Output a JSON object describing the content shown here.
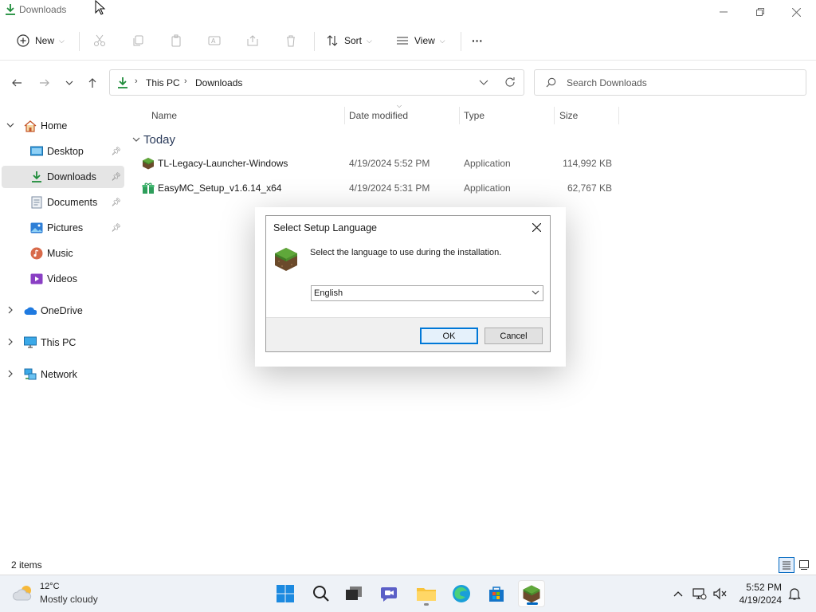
{
  "window": {
    "title": "Downloads"
  },
  "commandbar": {
    "new_label": "New",
    "sort_label": "Sort",
    "view_label": "View",
    "more_label": "···"
  },
  "address": {
    "crumbs": [
      "This PC",
      "Downloads"
    ],
    "search_placeholder": "Search Downloads"
  },
  "sidebar": {
    "items": [
      {
        "label": "Home",
        "icon": "home-icon"
      },
      {
        "label": "Desktop",
        "icon": "desktop-icon"
      },
      {
        "label": "Downloads",
        "icon": "download-icon"
      },
      {
        "label": "Documents",
        "icon": "documents-icon"
      },
      {
        "label": "Pictures",
        "icon": "pictures-icon"
      },
      {
        "label": "Music",
        "icon": "music-icon"
      },
      {
        "label": "Videos",
        "icon": "videos-icon"
      },
      {
        "label": "OneDrive",
        "icon": "onedrive-icon"
      },
      {
        "label": "This PC",
        "icon": "this-pc-icon"
      },
      {
        "label": "Network",
        "icon": "network-icon"
      }
    ]
  },
  "filelist": {
    "columns": [
      "Name",
      "Date modified",
      "Type",
      "Size"
    ],
    "group": "Today",
    "files": [
      {
        "name": "TL-Legacy-Launcher-Windows",
        "date": "4/19/2024 5:52 PM",
        "type": "Application",
        "size": "114,992 KB",
        "icon": "grass-block-icon"
      },
      {
        "name": "EasyMC_Setup_v1.6.14_x64",
        "date": "4/19/2024 5:31 PM",
        "type": "Application",
        "size": "62,767 KB",
        "icon": "installer-gift-icon"
      }
    ]
  },
  "status": {
    "count": "2 items"
  },
  "dialog": {
    "title": "Select Setup Language",
    "message": "Select the language to use during the installation.",
    "selected_language": "English",
    "ok_label": "OK",
    "cancel_label": "Cancel"
  },
  "taskbar": {
    "weather_temp": "12°C",
    "weather_desc": "Mostly cloudy",
    "time": "5:52 PM",
    "date": "4/19/2024"
  },
  "colors": {
    "accent": "#0067c0",
    "download_green": "#1e8c3a",
    "selection_bg": "#e5e5e5"
  }
}
